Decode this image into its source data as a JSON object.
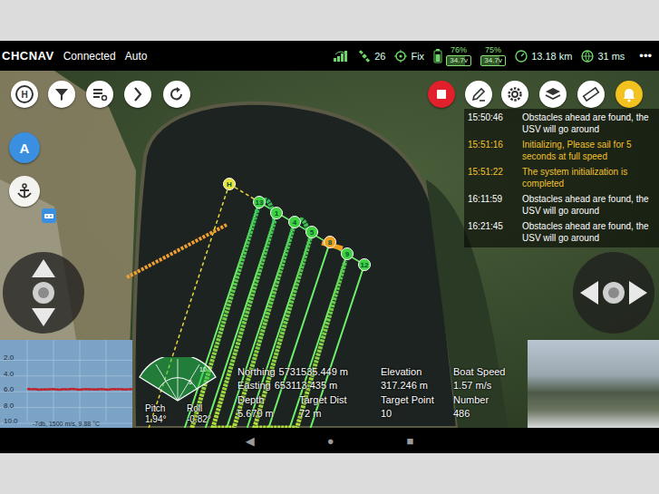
{
  "status_bar": {
    "logo": "CHCNAV",
    "connection": "Connected",
    "mode": "Auto",
    "satellites": "26",
    "fix": "Fix",
    "batteries": [
      {
        "percent": "76%",
        "voltage": "34.7v",
        "level": 0.76
      },
      {
        "percent": "75%",
        "voltage": "34.7v",
        "level": 0.75
      }
    ],
    "distance": "13.18 km",
    "latency": "31 ms",
    "more": "•••"
  },
  "left_tools": {
    "home_label": "H",
    "mode_button": "A"
  },
  "log": [
    {
      "time": "15:50:46",
      "message": "Obstacles ahead are found, the USV will go around",
      "color": "#ffffff"
    },
    {
      "time": "15:51:16",
      "message": "Initializing, Please sail for 5 seconds at full speed",
      "color": "#f2c12e"
    },
    {
      "time": "15:51:22",
      "message": "The system initialization is completed",
      "color": "#f2c12e"
    },
    {
      "time": "16:11:59",
      "message": "Obstacles ahead are found, the USV will go around",
      "color": "#ffffff"
    },
    {
      "time": "16:21:45",
      "message": "Obstacles ahead are found, the USV will go around",
      "color": "#ffffff"
    }
  ],
  "map": {
    "waypoints": [
      {
        "label": "H",
        "color": "#e6e23a"
      },
      {
        "label": "13",
        "color": "#3fd13f"
      },
      {
        "label": "1",
        "color": "#3fd13f"
      },
      {
        "label": "4",
        "color": "#3fd13f"
      },
      {
        "label": "5",
        "color": "#3fd13f"
      },
      {
        "label": "8",
        "color": "#f0a020"
      },
      {
        "label": "9",
        "color": "#3fd13f"
      },
      {
        "label": "12",
        "color": "#3fd13f"
      }
    ]
  },
  "depth_chart": {
    "ticks": [
      "2.0",
      "4.0",
      "6.0",
      "8.0",
      "10.0"
    ],
    "series": [
      5.62,
      5.7,
      5.66,
      5.74,
      5.68,
      5.72,
      5.65,
      5.7,
      5.75,
      5.67,
      5.71,
      5.64,
      5.69,
      5.73,
      5.66,
      5.7,
      5.68,
      5.72,
      5.65,
      5.7,
      5.74,
      5.67,
      5.7,
      5.66,
      5.72,
      5.69,
      5.67
    ],
    "footer": "-7db, 1500 m/s, 9.88 °C"
  },
  "attitude": {
    "ring_labels": [
      "5",
      "10"
    ],
    "pitch_label": "Pitch",
    "pitch": "1.94°",
    "roll_label": "Roll",
    "roll": "-0.82°"
  },
  "readings": {
    "inline": [
      {
        "label": "Northing",
        "value": "5731535.449 m"
      },
      {
        "label": "Easting",
        "value": "653113.435 m"
      }
    ],
    "stacked": [
      {
        "label": "Depth",
        "value": "5.670 m"
      },
      {
        "label": "Target Dist",
        "value": "72 m"
      },
      {
        "label": "Elevation",
        "value": "317.246 m"
      },
      {
        "label": "Target Point",
        "value": "10"
      },
      {
        "label": "Boat Speed",
        "value": "1.57 m/s"
      },
      {
        "label": "Number",
        "value": "486"
      }
    ]
  },
  "nav_bar": {
    "back": "◀",
    "home": "●",
    "recent": "■"
  }
}
